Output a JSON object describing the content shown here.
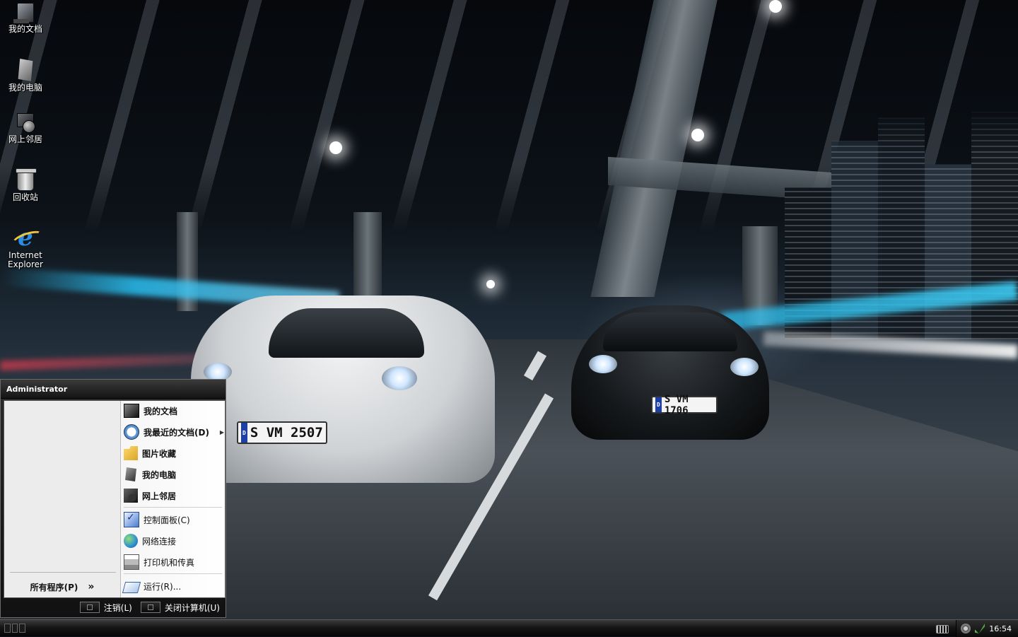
{
  "desktop": {
    "icons": [
      {
        "label": "我的文档",
        "icon": "my-documents-icon"
      },
      {
        "label": "我的电脑",
        "icon": "my-computer-icon"
      },
      {
        "label": "网上邻居",
        "icon": "network-places-icon"
      },
      {
        "label": "回收站",
        "icon": "recycle-bin-icon"
      },
      {
        "label": "Internet Explorer",
        "icon": "internet-explorer-icon"
      }
    ],
    "wallpaper": {
      "plate_white": "S VM 2507",
      "plate_black": "S VM 1706"
    }
  },
  "start_menu": {
    "user": "Administrator",
    "all_programs": "所有程序(P)",
    "all_programs_arrow": "»",
    "right_items": [
      {
        "label": "我的文档",
        "icon": "my-documents-icon",
        "bold": true
      },
      {
        "label": "我最近的文档(D)",
        "icon": "recent-documents-icon",
        "bold": true,
        "submenu": true
      },
      {
        "label": "图片收藏",
        "icon": "my-pictures-icon",
        "bold": true
      },
      {
        "label": "我的电脑",
        "icon": "my-computer-icon",
        "bold": true
      },
      {
        "label": "网上邻居",
        "icon": "network-places-icon",
        "bold": true
      },
      {
        "label": "控制面板(C)",
        "icon": "control-panel-icon",
        "bold": false
      },
      {
        "label": "网络连接",
        "icon": "network-connections-icon",
        "bold": false
      },
      {
        "label": "打印机和传真",
        "icon": "printers-icon",
        "bold": false
      },
      {
        "label": "运行(R)...",
        "icon": "run-icon",
        "bold": false
      }
    ],
    "footer": {
      "logoff": "注销(L)",
      "shutdown": "关闭计算机(U)"
    }
  },
  "taskbar": {
    "clock": "16:54"
  },
  "colors": {
    "taskbar": "#161616",
    "menu_panel": "#ffffff",
    "menu_left_panel": "#ececec"
  }
}
